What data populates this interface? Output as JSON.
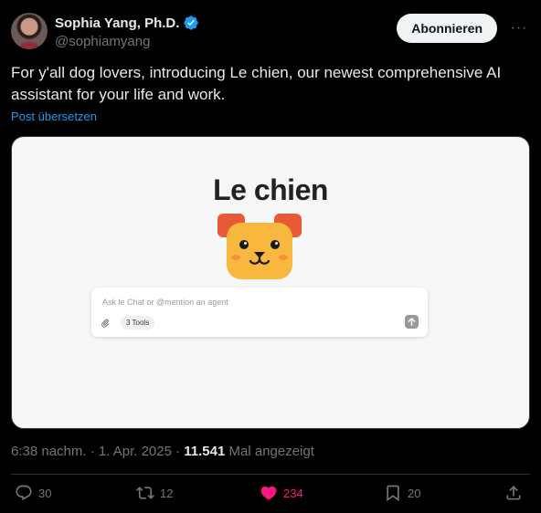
{
  "author": {
    "display_name": "Sophia Yang, Ph.D.",
    "handle": "@sophiamyang"
  },
  "follow_label": "Abonnieren",
  "more_label": "···",
  "tweet": {
    "text": "For y'all dog lovers, introducing Le chien, our newest comprehensive AI assistant for your life and work.",
    "translate_label": "Post übersetzen"
  },
  "media": {
    "title": "Le chien",
    "chat_placeholder": "Ask le Chat or @mention an agent",
    "tools_label": "3 Tools"
  },
  "meta": {
    "time_date": "6:38 nachm. · 1. Apr. 2025 · ",
    "views_count": "11.541",
    "views_label": " Mal angezeigt"
  },
  "actions": {
    "replies": "30",
    "reposts": "12",
    "likes": "234",
    "bookmarks": "20"
  },
  "colors": {
    "accent": "#1d9bf0",
    "like": "#f91880",
    "muted": "#71767b"
  }
}
